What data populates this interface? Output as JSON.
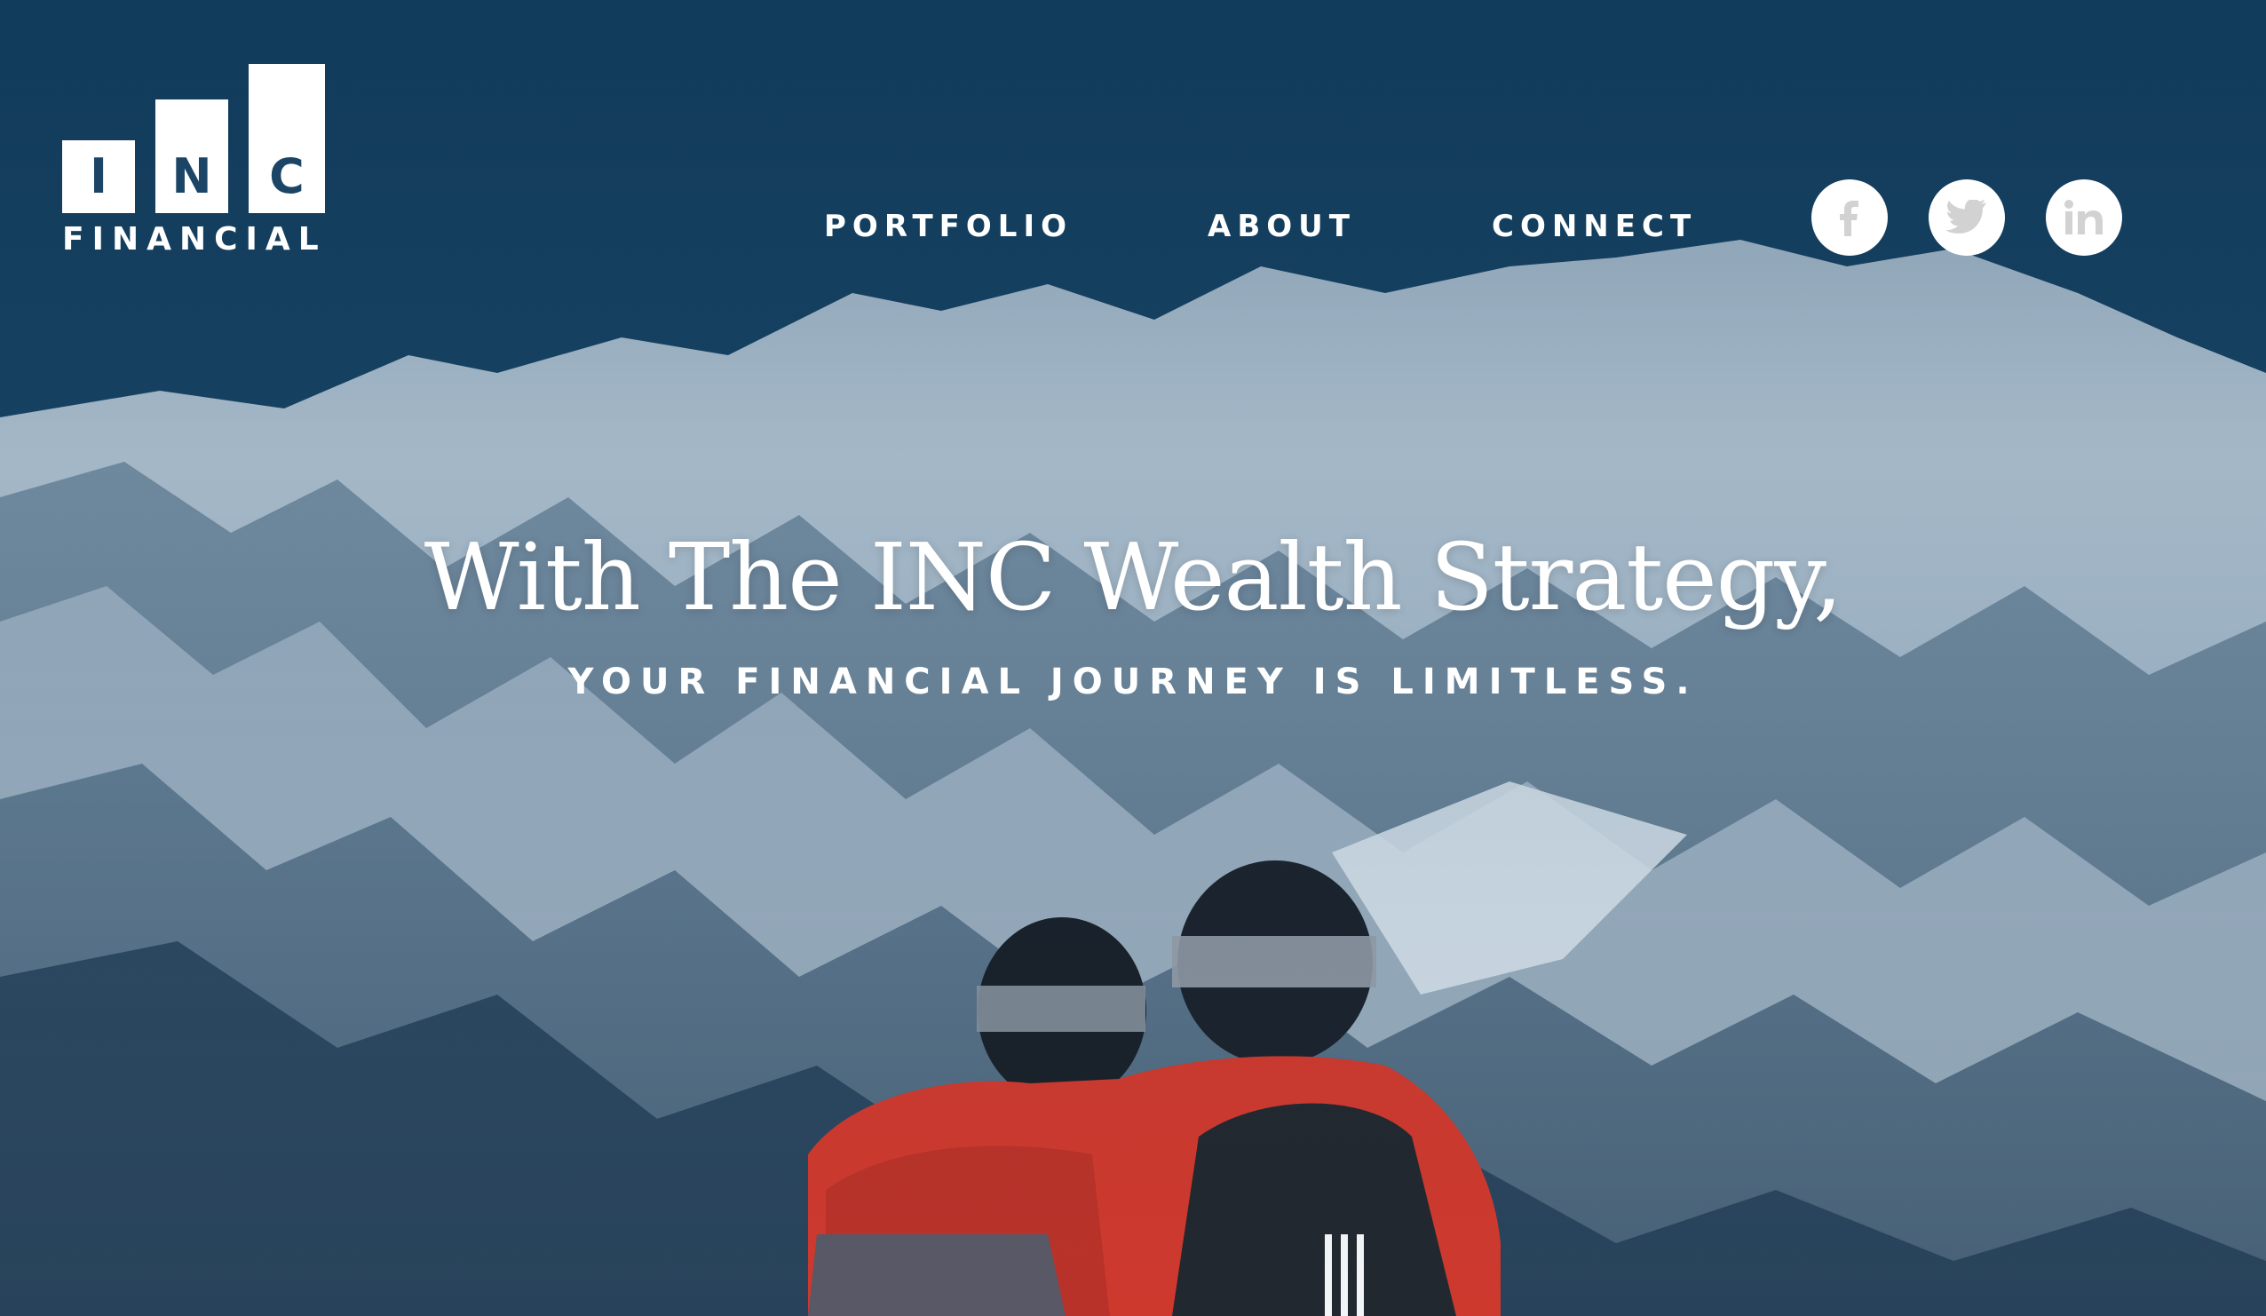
{
  "logo": {
    "letters": [
      "I",
      "N",
      "C"
    ],
    "wordmark": "FINANCIAL"
  },
  "nav": {
    "items": [
      {
        "label": "PORTFOLIO"
      },
      {
        "label": "ABOUT"
      },
      {
        "label": "CONNECT"
      }
    ]
  },
  "social": {
    "items": [
      {
        "icon": "facebook-icon"
      },
      {
        "icon": "twitter-icon"
      },
      {
        "icon": "linkedin-icon"
      }
    ],
    "icon_color": "#d2d2d2"
  },
  "hero": {
    "headline": "With The INC Wealth Strategy,",
    "subheadline": "YOUR FINANCIAL JOURNEY IS LIMITLESS.",
    "background_image": "snowy-mountain-range-with-two-hikers"
  },
  "colors": {
    "navy": "#1b4566",
    "white": "#ffffff",
    "jacket_red": "#d8392b"
  }
}
